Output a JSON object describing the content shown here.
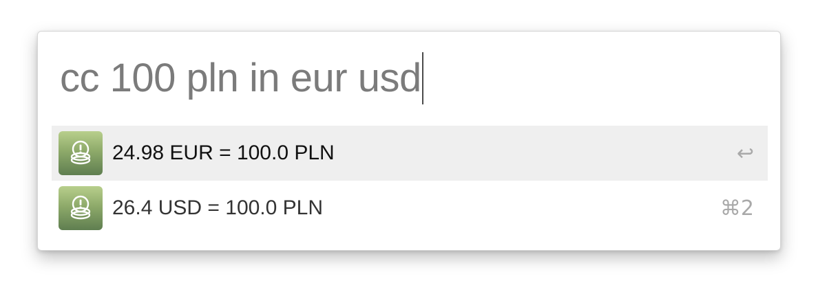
{
  "search": {
    "query": "cc 100 pln in eur usd"
  },
  "results": [
    {
      "title": "24.98 EUR = 100.0 PLN",
      "shortcut": "↩",
      "icon": "currency-coins-icon",
      "selected": true
    },
    {
      "title": "26.4 USD = 100.0 PLN",
      "shortcut": "⌘2",
      "icon": "currency-coins-icon",
      "selected": false
    }
  ],
  "colors": {
    "query_text": "#7b7b7b",
    "selected_row": "#efefef",
    "icon_gradient_top": "#b8cf8c",
    "icon_gradient_bottom": "#5f7e50",
    "shortcut_text": "#a9a9a9"
  }
}
